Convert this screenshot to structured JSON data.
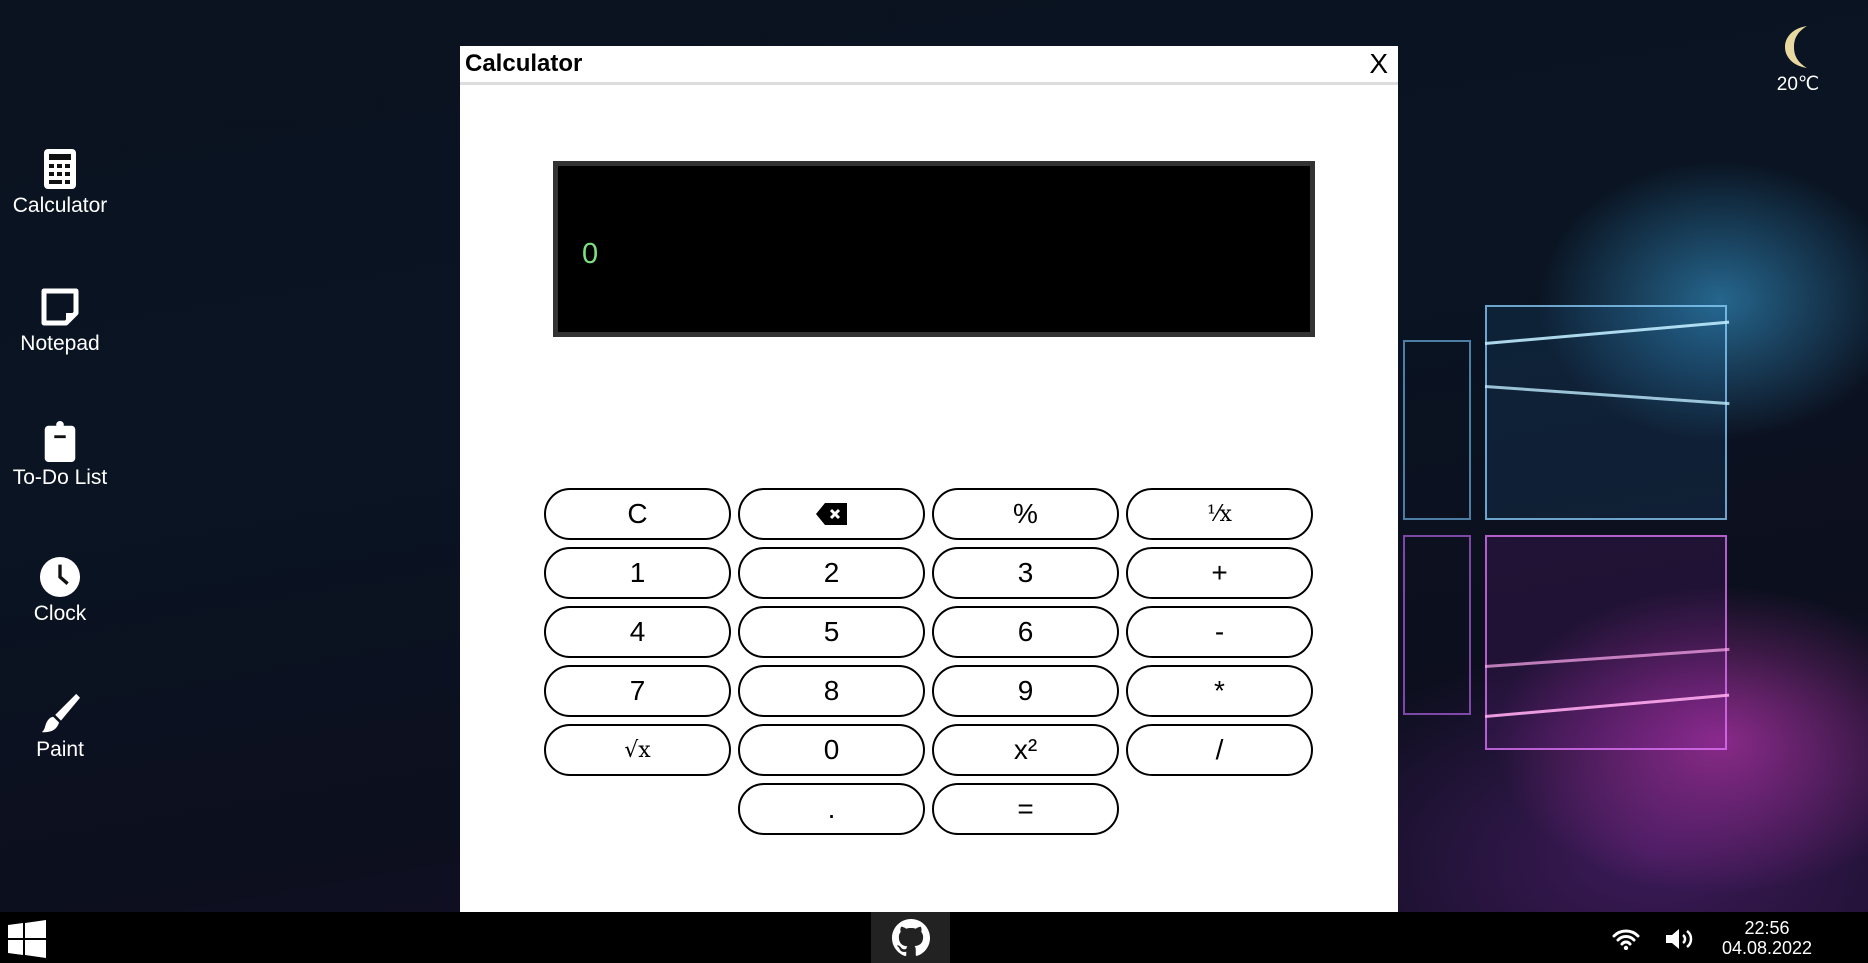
{
  "desktop": {
    "icons": [
      {
        "label": "Calculator",
        "icon": "calculator-icon"
      },
      {
        "label": "Notepad",
        "icon": "note-icon"
      },
      {
        "label": "To-Do List",
        "icon": "clipboard-icon"
      },
      {
        "label": "Clock",
        "icon": "clock-icon"
      },
      {
        "label": "Paint",
        "icon": "paintbrush-icon"
      }
    ]
  },
  "weather": {
    "icon": "moon-icon",
    "temperature": "20℃",
    "icon_color": "#e8d9a0"
  },
  "window": {
    "title": "Calculator",
    "close_label": "X"
  },
  "calculator": {
    "display": "0",
    "display_color": "#7ee07e",
    "buttons": [
      "C",
      "⌫",
      "%",
      "¹⁄x",
      "1",
      "2",
      "3",
      "+",
      "4",
      "5",
      "6",
      "-",
      "7",
      "8",
      "9",
      "*",
      "√x",
      "0",
      "x²",
      "/",
      ".",
      "="
    ]
  },
  "taskbar": {
    "time": "22:56",
    "date": "04.08.2022"
  }
}
